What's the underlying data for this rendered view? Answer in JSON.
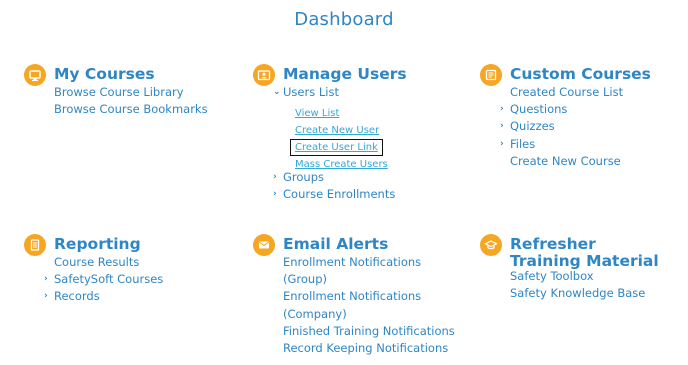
{
  "page_title": "Dashboard",
  "colors": {
    "accent_blue": "#2f86c4",
    "link_blue": "#35a8d8",
    "icon_orange": "#f5a623"
  },
  "sections": {
    "my_courses": {
      "title": "My Courses",
      "icon": "monitor-icon",
      "items": [
        "Browse Course Library",
        "Browse Course Bookmarks"
      ]
    },
    "manage_users": {
      "title": "Manage Users",
      "icon": "id-card-icon",
      "users_list": {
        "label": "Users List",
        "subitems": [
          "View List",
          "Create New User",
          "Create User Link",
          "Mass Create Users"
        ]
      },
      "groups": "Groups",
      "course_enrollments": "Course Enrollments"
    },
    "custom_courses": {
      "title": "Custom Courses",
      "icon": "book-icon",
      "created_list": "Created Course List",
      "questions": "Questions",
      "quizzes": "Quizzes",
      "files": "Files",
      "create_new": "Create New Course"
    },
    "reporting": {
      "title": "Reporting",
      "icon": "document-icon",
      "course_results": "Course Results",
      "safetysoft_courses": "SafetySoft Courses",
      "records": "Records"
    },
    "email_alerts": {
      "title": "Email Alerts",
      "icon": "envelope-icon",
      "items": [
        "Enrollment Notifications (Group)",
        "Enrollment Notifications (Company)",
        "Finished Training Notifications",
        "Record Keeping Notifications"
      ]
    },
    "refresher": {
      "title": "Refresher Training Material",
      "icon": "graduation-cap-icon",
      "items": [
        "Safety Toolbox",
        "Safety Knowledge Base"
      ]
    }
  }
}
